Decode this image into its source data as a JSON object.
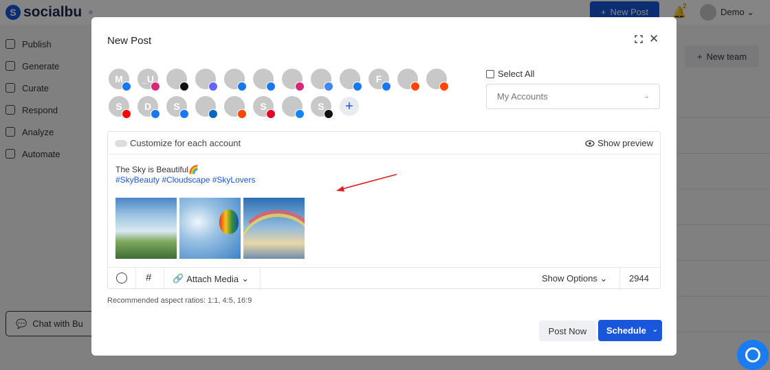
{
  "app": {
    "brand": "socialbu",
    "new_post_button": "New Post",
    "notification_count": "2",
    "user_name": "Demo",
    "new_team_button": "New team",
    "chat_button": "Chat with Bu",
    "sidebar": [
      {
        "label": "Publish",
        "icon": "send-icon"
      },
      {
        "label": "Generate",
        "icon": "sparkle-icon"
      },
      {
        "label": "Curate",
        "icon": "curate-icon"
      },
      {
        "label": "Respond",
        "icon": "chat-icon"
      },
      {
        "label": "Analyze",
        "icon": "chart-icon"
      },
      {
        "label": "Automate",
        "icon": "repeat-icon"
      }
    ]
  },
  "modal": {
    "title": "New Post",
    "select_all_label": "Select All",
    "accounts_dropdown": "My Accounts",
    "customize_label": "Customize for each account",
    "show_preview_label": "Show preview",
    "post_text": "The Sky is Beautiful🌈",
    "post_hashtags": "#SkyBeauty #Cloudscape #SkyLovers",
    "attach_media_label": "Attach Media",
    "show_options_label": "Show Options",
    "char_count": "2944",
    "aspect_note": "Recommended aspect ratios: 1:1, 4:5, 16:9",
    "post_now_label": "Post Now",
    "schedule_label": "Schedule",
    "accounts": [
      {
        "initial": "M",
        "network": "facebook",
        "color": "#1877f2"
      },
      {
        "initial": "_U",
        "network": "instagram",
        "color": "#d62976"
      },
      {
        "initial": "",
        "network": "x",
        "color": "#111111"
      },
      {
        "initial": "",
        "network": "mastodon",
        "color": "#6364ff"
      },
      {
        "initial": "",
        "network": "facebook",
        "color": "#1877f2"
      },
      {
        "initial": "",
        "network": "facebook",
        "color": "#1877f2"
      },
      {
        "initial": "",
        "network": "instagram",
        "color": "#d62976"
      },
      {
        "initial": "",
        "network": "google-business",
        "color": "#4285f4"
      },
      {
        "initial": "",
        "network": "facebook",
        "color": "#1877f2"
      },
      {
        "initial": "F",
        "network": "facebook",
        "color": "#1877f2"
      },
      {
        "initial": "",
        "network": "reddit",
        "color": "#ff4500"
      },
      {
        "initial": "",
        "network": "reddit",
        "color": "#ff4500"
      },
      {
        "initial": "S",
        "network": "youtube",
        "color": "#ff0000"
      },
      {
        "initial": "D",
        "network": "facebook",
        "color": "#1877f2"
      },
      {
        "initial": "S",
        "network": "facebook",
        "color": "#1877f2"
      },
      {
        "initial": "",
        "network": "linkedin",
        "color": "#0a66c2"
      },
      {
        "initial": "",
        "network": "reddit",
        "color": "#ff4500"
      },
      {
        "initial": "S",
        "network": "pinterest",
        "color": "#e60023"
      },
      {
        "initial": "",
        "network": "bluesky",
        "color": "#1185fe"
      },
      {
        "initial": "S",
        "network": "tiktok",
        "color": "#111111"
      }
    ]
  }
}
